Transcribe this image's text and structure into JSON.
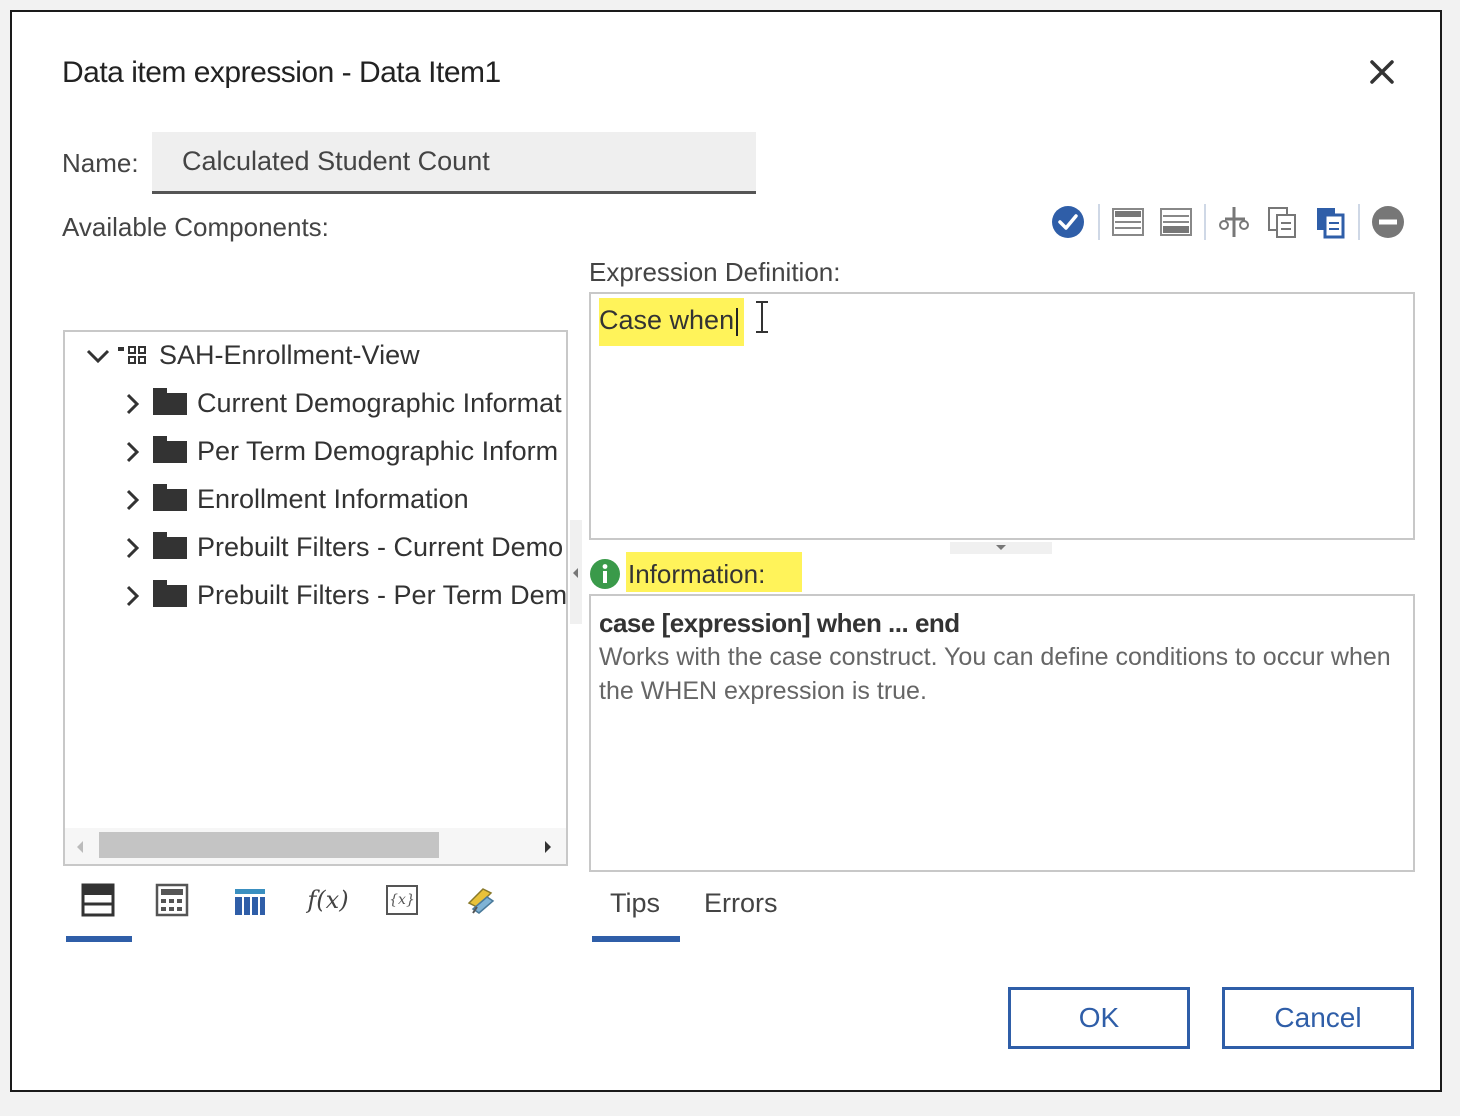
{
  "dialog": {
    "title": "Data item expression - Data Item1"
  },
  "name_field": {
    "label": "Name:",
    "value": "Calculated Student Count"
  },
  "available_components_label": "Available Components:",
  "toolbar": {
    "icons": [
      "validate-check-icon",
      "insert-above-icon",
      "insert-below-icon",
      "cut-icon",
      "copy-icon",
      "paste-icon",
      "remove-icon"
    ]
  },
  "expression": {
    "label": "Expression Definition:",
    "text": "Case when"
  },
  "information": {
    "label": "Information:",
    "heading": "case [expression] when ... end",
    "body": "Works with the case construct. You can define conditions to occur when the WHEN expression is true."
  },
  "tree": {
    "root": "SAH-Enrollment-View",
    "items": [
      {
        "label": "Current Demographic Informat"
      },
      {
        "label": "Per Term Demographic Inform"
      },
      {
        "label": "Enrollment Information"
      },
      {
        "label": "Prebuilt Filters - Current Demo"
      },
      {
        "label": "Prebuilt Filters - Per Term Dem"
      }
    ]
  },
  "bottom_tabs": {
    "icons": [
      "data-items-icon",
      "calculator-icon",
      "columns-icon",
      "functions-icon",
      "parameters-icon",
      "macros-icon"
    ],
    "functions_label": "f(x)",
    "parameters_label": "{x}"
  },
  "info_tabs": {
    "tips": "Tips",
    "errors": "Errors"
  },
  "buttons": {
    "ok": "OK",
    "cancel": "Cancel"
  },
  "colors": {
    "accent": "#2f5ea8",
    "highlight": "#fff35a",
    "info_green": "#3a9a4a"
  }
}
